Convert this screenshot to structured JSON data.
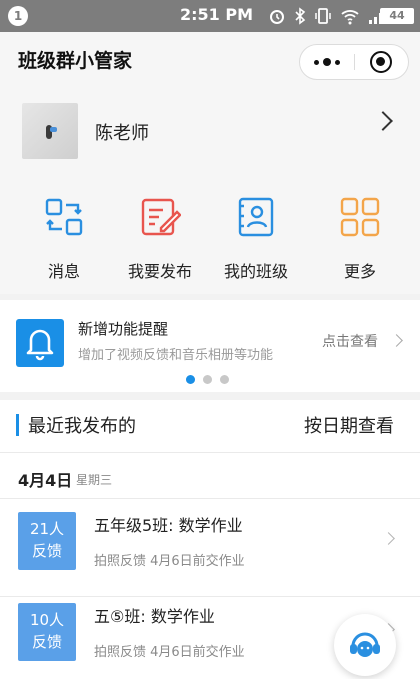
{
  "status_bar": {
    "notification_count": "1",
    "time": "2:51 PM",
    "battery": "44"
  },
  "header": {
    "title": "班级群小管家"
  },
  "profile": {
    "name": "陈老师"
  },
  "menu": [
    {
      "label": "消息",
      "icon": "message-swap-icon"
    },
    {
      "label": "我要发布",
      "icon": "edit-document-icon"
    },
    {
      "label": "我的班级",
      "icon": "class-id-card-icon"
    },
    {
      "label": "更多",
      "icon": "grid-more-icon"
    }
  ],
  "notice": {
    "title": "新增功能提醒",
    "subtitle": "增加了视频反馈和音乐相册等功能",
    "link": "点击查看",
    "carousel_total": 3,
    "carousel_active": 1
  },
  "recent": {
    "title": "最近我发布的",
    "sort_link": "按日期查看",
    "date": "4月4日",
    "weekday": "星期三",
    "items": [
      {
        "count": "21人",
        "status": "反馈",
        "title": "五年级5班: 数学作业",
        "subtitle": "拍照反馈  4月6日前交作业"
      },
      {
        "count": "10人",
        "status": "反馈",
        "title": "五⑤班: 数学作业",
        "subtitle": "拍照反馈  4月6日前交作业"
      }
    ]
  },
  "colors": {
    "accent": "#1a8fe6",
    "badge_blue": "#5aa0e8",
    "icon_red": "#e8554e",
    "icon_orange": "#f3a54a"
  }
}
